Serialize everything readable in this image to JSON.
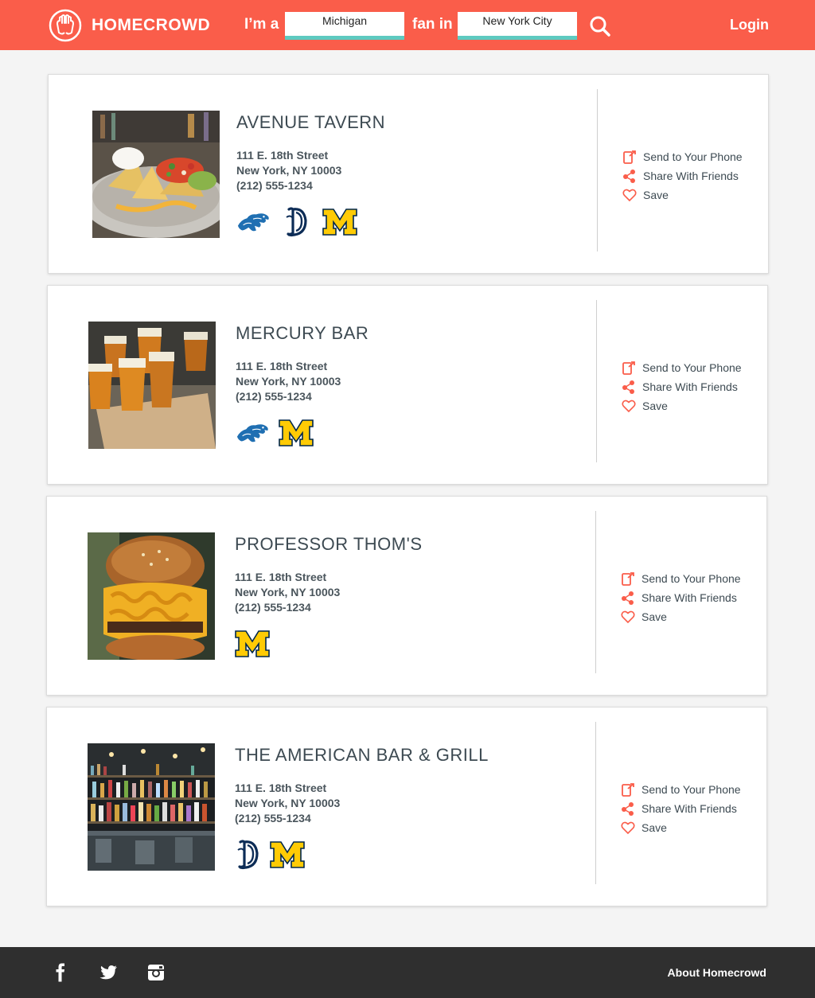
{
  "header": {
    "brand": "HOMECROWD",
    "im_a": "I’m a",
    "team_value": "Michigan",
    "fan_in": "fan in",
    "city_value": "New York City",
    "login": "Login"
  },
  "actions": {
    "send": "Send to Your Phone",
    "share": "Share With Friends",
    "save": "Save"
  },
  "venues": [
    {
      "name": "AVENUE TAVERN",
      "street": "111 E. 18th Street",
      "city": "New York, NY 10003",
      "phone": "(212) 555-1234",
      "photo": "nachos-photo",
      "team_logos": [
        "detroit-lions-logo",
        "detroit-tigers-logo",
        "michigan-logo"
      ]
    },
    {
      "name": "MERCURY BAR",
      "street": "111 E. 18th Street",
      "city": "New York, NY 10003",
      "phone": "(212) 555-1234",
      "photo": "beer-flight-photo",
      "team_logos": [
        "detroit-lions-logo",
        "michigan-logo"
      ]
    },
    {
      "name": "PROFESSOR THOM'S",
      "street": "111 E. 18th Street",
      "city": "New York, NY 10003",
      "phone": "(212) 555-1234",
      "photo": "mac-cheese-burger-photo",
      "team_logos": [
        "michigan-logo"
      ]
    },
    {
      "name": "THE AMERICAN BAR & GRILL",
      "street": "111 E. 18th Street",
      "city": "New York, NY 10003",
      "phone": "(212) 555-1234",
      "photo": "bar-shelves-photo",
      "team_logos": [
        "detroit-tigers-logo",
        "michigan-logo"
      ]
    }
  ],
  "footer": {
    "social": [
      "facebook-icon",
      "twitter-icon",
      "instagram-icon"
    ],
    "about": "About Homecrowd"
  },
  "colors": {
    "header_bg": "#fa5d4a",
    "input_underline": "#5ecac0",
    "footer_bg": "#2f2f2f",
    "action_icon": "#fa5d4a",
    "michigan_maize": "#ffcb05",
    "detroit_blue": "#1f6fb2"
  }
}
